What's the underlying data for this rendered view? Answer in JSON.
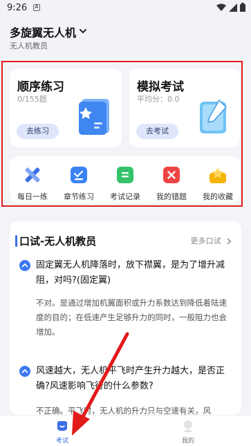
{
  "status": {
    "time": "9:26",
    "notif": "A"
  },
  "header": {
    "title": "多旋翼无人机",
    "subtitle": "无人机教员"
  },
  "cards": [
    {
      "title": "顺序练习",
      "sub": "0/155题",
      "button": "去练习",
      "icon": "book-icon"
    },
    {
      "title": "模拟考试",
      "sub": "平均分：0.0",
      "button": "去考试",
      "icon": "notebook-pencil-icon"
    }
  ],
  "quick": [
    {
      "label": "每日一练",
      "icon": "pencil-ruler-icon",
      "color": "#3b6fe8"
    },
    {
      "label": "章节练习",
      "icon": "checklist-icon",
      "color": "#3b82f6"
    },
    {
      "label": "考试记录",
      "icon": "record-icon",
      "color": "#34c26a"
    },
    {
      "label": "我的错题",
      "icon": "wrong-icon",
      "color": "#ef4444"
    },
    {
      "label": "我的收藏",
      "icon": "star-box-icon",
      "color": "#f5b301"
    }
  ],
  "oral": {
    "title": "口试-无人机教员",
    "more": "更多口试",
    "items": [
      {
        "q": "固定翼无人机降落时，放下襟翼，是为了增升减阻，对吗?(固定翼)",
        "a": "不对。是通过增加机翼面积或升力系数达到降低着陆速度的目的；在低速产生足够升力的同时，一般阻力也会增加。"
      },
      {
        "q": "风速越大，无人机平飞时产生升力越大，是否正确?风速影响飞行的什么参数?",
        "a": "不正确。平飞时，无人机的升力只与空速有关，风"
      }
    ]
  },
  "tabs": [
    {
      "label": "考试"
    },
    {
      "label": "我的"
    }
  ],
  "colors": {
    "accent": "#3a6ee8",
    "highlight": "#e21a1a"
  }
}
